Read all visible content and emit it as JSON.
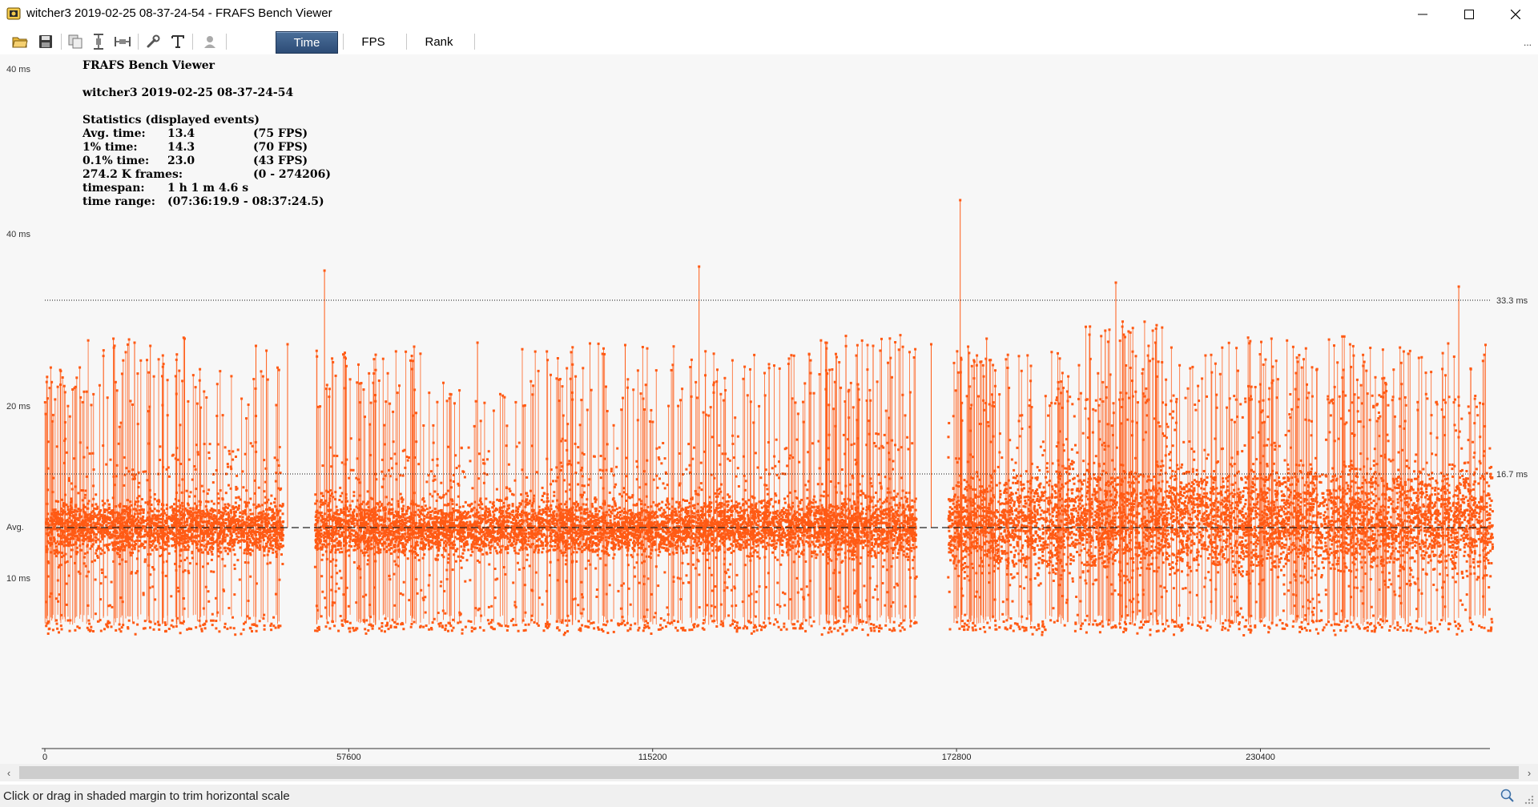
{
  "window": {
    "title": "witcher3 2019-02-25 08-37-24-54 - FRAFS Bench Viewer"
  },
  "toolbar": {
    "icons": [
      "open-folder-icon",
      "save-icon",
      "copy-icon",
      "vertical-scale-icon",
      "horizontal-scale-icon",
      "wrench-icon",
      "text-icon",
      "user-icon"
    ],
    "modes": {
      "time": "Time",
      "fps": "FPS",
      "rank": "Rank"
    },
    "active_mode": "Time",
    "more": "..."
  },
  "stats": {
    "app_name": "FRAFS Bench Viewer",
    "run_name": "witcher3 2019-02-25 08-37-24-54",
    "header": "Statistics (displayed events)",
    "rows": [
      {
        "label": "Avg. time:",
        "value": "13.4",
        "extra": "(75 FPS)"
      },
      {
        "label": "1% time:",
        "value": "14.3",
        "extra": "(70 FPS)"
      },
      {
        "label": "0.1% time:",
        "value": "23.0",
        "extra": "(43 FPS)"
      }
    ],
    "frames": {
      "label": "274.2 K frames:",
      "value": "(0 - 274206)"
    },
    "timespan": {
      "label": "timespan:",
      "value": "1 h 1 m 4.6 s"
    },
    "time_range": {
      "label": "time range:",
      "value": "(07:36:19.9 - 08:37:24.5)"
    }
  },
  "chart_data": {
    "type": "scatter",
    "title": "",
    "xlabel": "",
    "ylabel": "",
    "x_range": [
      0,
      274206
    ],
    "x_ticks": [
      0,
      57600,
      115200,
      172800,
      230400
    ],
    "x_tick_labels": [
      "0",
      "57600",
      "115200",
      "172800",
      "230400"
    ],
    "y_tick_labels": [
      "40 ms",
      "40 ms",
      "20 ms",
      "Avg.",
      "10 ms"
    ],
    "reference_lines": [
      {
        "label": "33.3 ms",
        "value": 33.3
      },
      {
        "label": "16.7 ms",
        "value": 16.7
      }
    ],
    "average_ms": 13.4,
    "series_color": "#ff5a14",
    "segments": [
      {
        "x0": 0,
        "x1": 8000,
        "base_ms": 13.4,
        "spread_ms": 1.4,
        "low_ms": 7.6,
        "spike_count": 30,
        "spike_min_ms": 19,
        "spike_max_ms": 25
      },
      {
        "x0": 8000,
        "x1": 28000,
        "base_ms": 13.4,
        "spread_ms": 1.3,
        "low_ms": 7.6,
        "spike_count": 45,
        "spike_min_ms": 19,
        "spike_max_ms": 29
      },
      {
        "x0": 28000,
        "x1": 45000,
        "base_ms": 13.4,
        "spread_ms": 1.3,
        "low_ms": 7.6,
        "spike_count": 25,
        "spike_min_ms": 19,
        "spike_max_ms": 25
      },
      {
        "x0": 51000,
        "x1": 72000,
        "base_ms": 13.4,
        "spread_ms": 1.4,
        "low_ms": 7.6,
        "spike_count": 55,
        "spike_min_ms": 19,
        "spike_max_ms": 27
      },
      {
        "x0": 72000,
        "x1": 90000,
        "base_ms": 13.4,
        "spread_ms": 1.3,
        "low_ms": 7.6,
        "spike_count": 20,
        "spike_min_ms": 19,
        "spike_max_ms": 23
      },
      {
        "x0": 90000,
        "x1": 108000,
        "base_ms": 13.4,
        "spread_ms": 1.4,
        "low_ms": 7.6,
        "spike_count": 40,
        "spike_min_ms": 19,
        "spike_max_ms": 28
      },
      {
        "x0": 108000,
        "x1": 125000,
        "base_ms": 13.4,
        "spread_ms": 1.3,
        "low_ms": 7.6,
        "spike_count": 30,
        "spike_min_ms": 19,
        "spike_max_ms": 28
      },
      {
        "x0": 125000,
        "x1": 144000,
        "base_ms": 13.5,
        "spread_ms": 1.4,
        "low_ms": 7.6,
        "spike_count": 40,
        "spike_min_ms": 19,
        "spike_max_ms": 27
      },
      {
        "x0": 144000,
        "x1": 165000,
        "base_ms": 13.5,
        "spread_ms": 1.5,
        "low_ms": 7.6,
        "spike_count": 65,
        "spike_min_ms": 19,
        "spike_max_ms": 29
      },
      {
        "x0": 171000,
        "x1": 180000,
        "base_ms": 13.6,
        "spread_ms": 2.2,
        "low_ms": 7.6,
        "spike_count": 35,
        "spike_min_ms": 19,
        "spike_max_ms": 27
      },
      {
        "x0": 180000,
        "x1": 197000,
        "base_ms": 13.8,
        "spread_ms": 2.5,
        "low_ms": 7.6,
        "spike_count": 30,
        "spike_min_ms": 19,
        "spike_max_ms": 27
      },
      {
        "x0": 197000,
        "x1": 212000,
        "base_ms": 13.9,
        "spread_ms": 2.6,
        "low_ms": 7.6,
        "spike_count": 55,
        "spike_min_ms": 19,
        "spike_max_ms": 31
      },
      {
        "x0": 212000,
        "x1": 228000,
        "base_ms": 13.9,
        "spread_ms": 2.5,
        "low_ms": 7.6,
        "spike_count": 25,
        "spike_min_ms": 19,
        "spike_max_ms": 29
      },
      {
        "x0": 228000,
        "x1": 248000,
        "base_ms": 13.9,
        "spread_ms": 2.6,
        "low_ms": 7.6,
        "spike_count": 55,
        "spike_min_ms": 19,
        "spike_max_ms": 29
      },
      {
        "x0": 248000,
        "x1": 274206,
        "base_ms": 13.9,
        "spread_ms": 2.6,
        "low_ms": 7.6,
        "spike_count": 55,
        "spike_min_ms": 19,
        "spike_max_ms": 28
      }
    ],
    "major_spikes": [
      {
        "x": 13000,
        "ms": 28.5
      },
      {
        "x": 17000,
        "ms": 28.0
      },
      {
        "x": 20000,
        "ms": 27.6
      },
      {
        "x": 26500,
        "ms": 28.5
      },
      {
        "x": 40000,
        "ms": 27.6
      },
      {
        "x": 42000,
        "ms": 27.0
      },
      {
        "x": 46000,
        "ms": 27.8
      },
      {
        "x": 53000,
        "ms": 37.0
      },
      {
        "x": 70000,
        "ms": 27.5
      },
      {
        "x": 82000,
        "ms": 28.0
      },
      {
        "x": 110000,
        "ms": 27.7
      },
      {
        "x": 124000,
        "ms": 37.5
      },
      {
        "x": 148000,
        "ms": 28.0
      },
      {
        "x": 157000,
        "ms": 27.6
      },
      {
        "x": 168000,
        "ms": 27.8
      },
      {
        "x": 173500,
        "ms": 40.5
      },
      {
        "x": 175000,
        "ms": 27.5
      },
      {
        "x": 178500,
        "ms": 28.5
      },
      {
        "x": 198000,
        "ms": 29.0
      },
      {
        "x": 201000,
        "ms": 29.5
      },
      {
        "x": 203000,
        "ms": 35.5
      },
      {
        "x": 204500,
        "ms": 29.0
      },
      {
        "x": 210500,
        "ms": 28.0
      },
      {
        "x": 232500,
        "ms": 28.5
      },
      {
        "x": 268000,
        "ms": 35.0
      }
    ]
  },
  "scrollbar": {
    "left_arrow": "‹",
    "right_arrow": "›"
  },
  "status": {
    "text": "Click or drag in shaded margin to trim horizontal scale"
  }
}
